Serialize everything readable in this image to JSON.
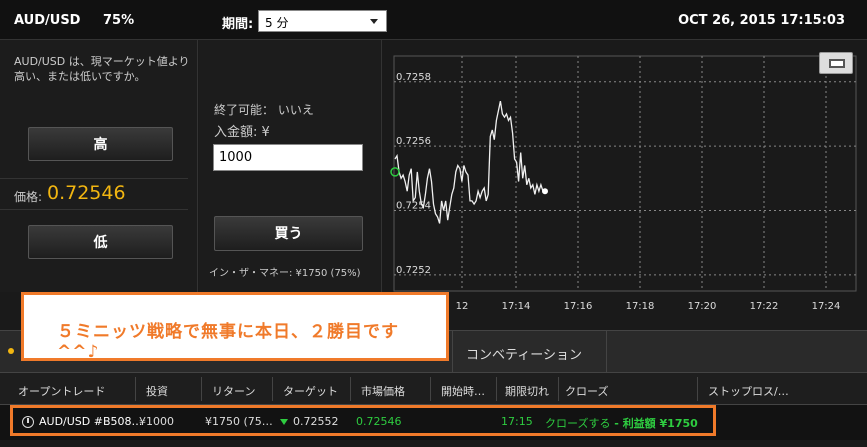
{
  "header": {
    "symbol": "AUD/USD",
    "percent": "75%",
    "period_label": "期間:",
    "period_value": "5 分",
    "datetime": "OCT 26, 2015 17:15:03"
  },
  "trade": {
    "question": "AUD/USD は、現マーケット値より高い、または低いですか。",
    "high_label": "高",
    "low_label": "低",
    "price_label": "価格:",
    "price_value": "0.72546",
    "expiry": "終了可能： いいえ",
    "amount_label": "入金額: ¥",
    "amount_value": "1000",
    "buy_label": "買う",
    "payout": "イン・ザ・マネー: ¥1750 (75%)"
  },
  "chart_data": {
    "type": "line",
    "y_ticks": [
      "0.7258",
      "0.7256",
      "0.7254",
      "0.7252"
    ],
    "x_ticks": [
      "12",
      "17:14",
      "17:16",
      "17:18",
      "17:20",
      "17:22",
      "17:24"
    ],
    "ylim": [
      0.72515,
      0.72588
    ],
    "grid": true,
    "series": [
      {
        "values": [
          [
            0,
            0.72556
          ],
          [
            0.3,
            0.72557
          ],
          [
            0.6,
            0.72552
          ],
          [
            0.9,
            0.7255
          ],
          [
            1.2,
            0.72551
          ],
          [
            1.5,
            0.72549
          ],
          [
            1.8,
            0.72546
          ],
          [
            2.1,
            0.72551
          ],
          [
            2.4,
            0.72553
          ],
          [
            2.7,
            0.72543
          ],
          [
            3.0,
            0.72544
          ],
          [
            3.3,
            0.72552
          ],
          [
            3.6,
            0.72546
          ],
          [
            3.9,
            0.72542
          ],
          [
            4.2,
            0.72541
          ],
          [
            4.5,
            0.72545
          ],
          [
            4.8,
            0.7255
          ],
          [
            5.1,
            0.72553
          ],
          [
            5.4,
            0.72549
          ],
          [
            5.7,
            0.72542
          ],
          [
            6.0,
            0.72539
          ],
          [
            6.3,
            0.72538
          ],
          [
            6.6,
            0.72536
          ],
          [
            6.9,
            0.72543
          ],
          [
            7.2,
            0.7254
          ],
          [
            7.5,
            0.72543
          ],
          [
            7.8,
            0.72537
          ],
          [
            8.1,
            0.72541
          ],
          [
            8.4,
            0.72545
          ],
          [
            8.7,
            0.72547
          ],
          [
            9.0,
            0.72552
          ],
          [
            9.3,
            0.72554
          ],
          [
            9.6,
            0.72553
          ],
          [
            9.9,
            0.72549
          ],
          [
            10.2,
            0.72554
          ],
          [
            10.5,
            0.72552
          ],
          [
            10.8,
            0.72551
          ],
          [
            11.1,
            0.72543
          ],
          [
            11.4,
            0.72543
          ],
          [
            11.7,
            0.72542
          ],
          [
            12.0,
            0.72543
          ],
          [
            12.3,
            0.72546
          ],
          [
            12.6,
            0.72544
          ],
          [
            12.9,
            0.72546
          ],
          [
            13.2,
            0.72547
          ],
          [
            13.5,
            0.72543
          ],
          [
            13.8,
            0.72545
          ],
          [
            14.1,
            0.72563
          ],
          [
            14.4,
            0.72565
          ],
          [
            14.7,
            0.72562
          ],
          [
            15.0,
            0.72568
          ],
          [
            15.3,
            0.72571
          ],
          [
            15.6,
            0.72574
          ],
          [
            15.9,
            0.7257
          ],
          [
            16.2,
            0.72569
          ],
          [
            16.5,
            0.7257
          ],
          [
            16.8,
            0.72568
          ],
          [
            17.1,
            0.72569
          ],
          [
            17.4,
            0.72564
          ],
          [
            17.7,
            0.72556
          ],
          [
            18.0,
            0.72555
          ],
          [
            18.3,
            0.72549
          ],
          [
            18.6,
            0.72558
          ],
          [
            18.9,
            0.7255
          ],
          [
            19.2,
            0.72554
          ],
          [
            19.5,
            0.72548
          ],
          [
            19.8,
            0.7255
          ],
          [
            20.1,
            0.72547
          ],
          [
            20.4,
            0.72548
          ],
          [
            20.7,
            0.72545
          ],
          [
            21.0,
            0.72548
          ],
          [
            21.3,
            0.72546
          ],
          [
            21.6,
            0.72548
          ],
          [
            21.9,
            0.72546
          ],
          [
            22.2,
            0.72546
          ]
        ]
      }
    ]
  },
  "annotation": "５ミニッツ戦略で無事に本日、２勝目です ^^♪",
  "tabs": {
    "active_tab_label": "",
    "convention_tab": "コンベティーション"
  },
  "table": {
    "headers": [
      "オープントレード",
      "投資",
      "リターン",
      "ターゲット",
      "市場価格",
      "開始時…",
      "期限切れ",
      "クローズ",
      "ストップロス/…"
    ],
    "row": {
      "asset": "AUD/USD #B508…",
      "investment": "¥1000",
      "return": "¥1750 (75…",
      "target": "0.72552",
      "market_price": "0.72546",
      "expiry": "17:15",
      "close_action": "クローズする",
      "close_dash": " - ",
      "close_profit": "利益額 ¥1750"
    }
  },
  "colors": {
    "accent": "#f2b611",
    "positive": "#2ecc40",
    "annotation": "#f07a2a"
  }
}
